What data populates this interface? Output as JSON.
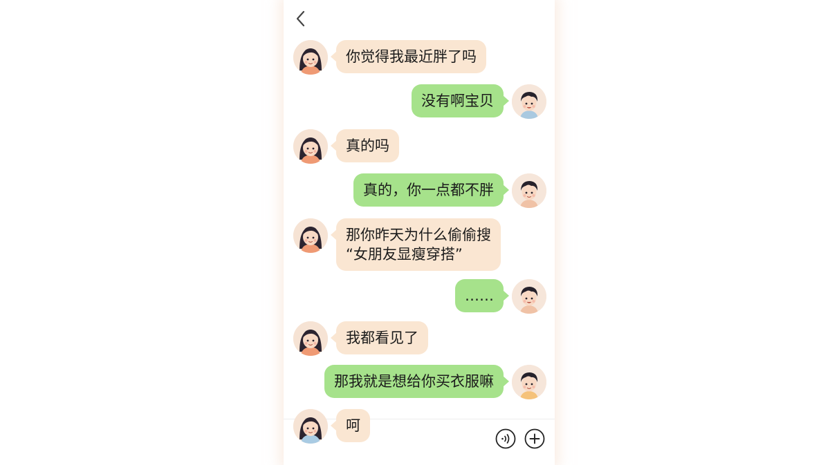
{
  "chat": {
    "messages": [
      {
        "sender": "her",
        "text": "你觉得我最近胖了吗"
      },
      {
        "sender": "him",
        "text": "没有啊宝贝"
      },
      {
        "sender": "her",
        "text": "真的吗"
      },
      {
        "sender": "him",
        "text": "真的，你一点都不胖"
      },
      {
        "sender": "her",
        "text": "那你昨天为什么偷偷搜\n“女朋友显瘦穿搭”"
      },
      {
        "sender": "him",
        "text": "……"
      },
      {
        "sender": "her",
        "text": "我都看见了"
      },
      {
        "sender": "him",
        "text": "那我就是想给你买衣服嘛"
      },
      {
        "sender": "her",
        "text": "呵"
      }
    ]
  },
  "icons": {
    "back": "chevron-left-icon",
    "voice": "voice-icon",
    "add": "plus-icon"
  },
  "colors": {
    "her_bubble": "#fae6d2",
    "his_bubble": "#a6e28b"
  }
}
